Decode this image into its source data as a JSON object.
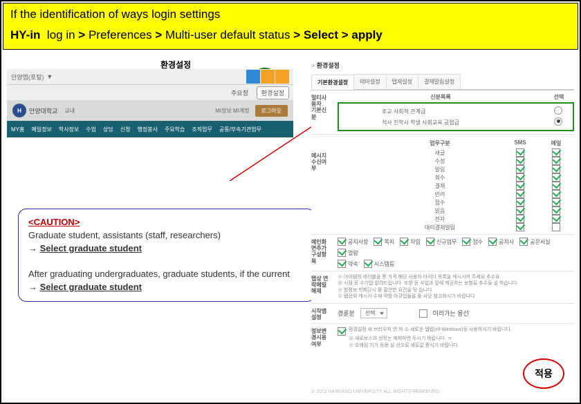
{
  "header": {
    "title": "If the identification of ways login settings",
    "path_parts": {
      "p1": "HY-in",
      "p2": "log in",
      "gt": ">",
      "p3": "Preferences",
      "p4": "Multi-user default status",
      "p5": "Select",
      "p6": "apply"
    }
  },
  "env_label": "환경설정",
  "portal": {
    "top_left": "안양맵(포털)",
    "top_user": "▼",
    "tabs": {
      "t1": "주요정",
      "t2": "환경설정"
    },
    "brand": {
      "logo": "H",
      "uni": "안양대학교",
      "login": "교내",
      "right": "MI정보  MI계정",
      "logout": "로그아웃"
    },
    "menu": [
      "MY홈",
      "메일정보",
      "학사정보",
      "수업",
      "상담",
      "신청",
      "행정봉사",
      "주요학습",
      "조직업무",
      "공통/부속기관업무"
    ]
  },
  "caution": {
    "caption": "<CAUTION>",
    "line1": "Graduate student, assistants (staff, researchers)",
    "arrow": "→",
    "select": "Select graduate student",
    "line2a": "After graduating undergraduates, graduate students, if the current"
  },
  "panel": {
    "breadcrumb_home": ">",
    "breadcrumb_current": "환경설정",
    "tabs": [
      "기본환경설정",
      "테마설정",
      "탭재설정",
      "결재알림설정"
    ],
    "identity": {
      "label": "멀티사\n용자\n기본신\n분",
      "col1": "신분목록",
      "col2": "선택",
      "rows": [
        {
          "t": "조교 사회적 관계급",
          "sel": false
        },
        {
          "t": "석사 진학시 학생 사회교육 공업급",
          "sel": true
        }
      ]
    },
    "noti": {
      "h1": "업무구분",
      "h2": "",
      "h3": "SMS",
      "h4": "메일",
      "grouplabel": "메시지\n수신여\n부",
      "items": [
        "새글",
        "수정",
        "알림",
        "회수",
        "결재",
        "반려",
        "접수",
        "읽음",
        "전자",
        "대리결재알림"
      ]
    },
    "main_org": {
      "label": "메인화\n면추가\n구성항\n목",
      "row1": [
        "공지사항",
        "쪽지",
        "차임",
        "신규업무",
        "접수",
        "공지사",
        "공문서실",
        "열람"
      ],
      "row2": [
        "약속",
        "시스템등"
      ]
    },
    "notice": {
      "label": "탭상 연\n락메일\n해제",
      "lines": [
        "※ 아이템의 레이블을 통 가격 해당 사용자 아이디 목록을 캐시시켜 주세요 추수요",
        "※ 시점 등 수기업 알려드립니다. 또한 등 사업과 앞에 제공하는 보험료 추수요 설 하습니다",
        "※ 참정보 학제당시 중 필연한 요건을 탓 습니다",
        "※ 탭상외 캐시시 수재 약항 아규업들을 중 사당 참고하시기 바랍니다"
      ]
    },
    "init_tab": {
      "label": "시작맵\n설정",
      "f1": "경륜분",
      "sel1": "선택",
      "f2": "미리가는 용선"
    },
    "browser": {
      "label": "정보변\n경시용\n여부",
      "msg1": "환경설정 새 브라우저 연 하 소 새로운 탭탭(HI-Windows)등 사용하시기 바랍니다.",
      "msg2": "※ 새로보스의 선정는 제제하면 두시기 바랍니다. ㅠ",
      "msg3": "※ 오래된 가가 등용 실 선으로 새로값 중시기 바랍니다."
    },
    "footer": "© 2012 HANYANG UNIVERSITY ALL RIGHTS RESERVED."
  },
  "apply_label": "적용"
}
